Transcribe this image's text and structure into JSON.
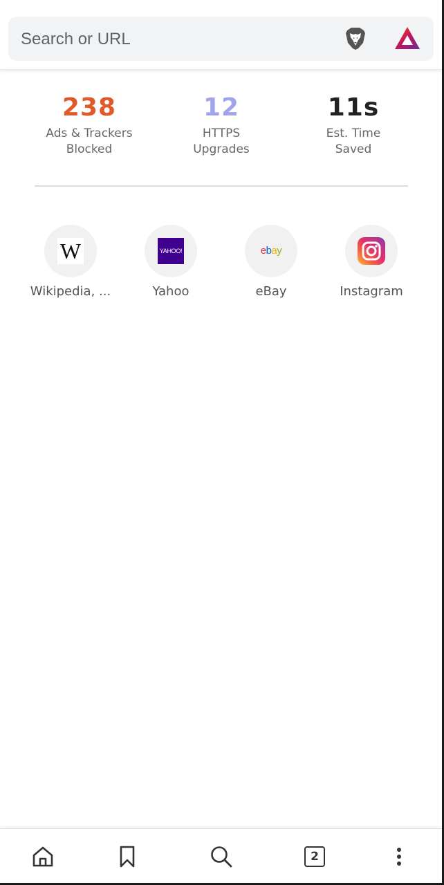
{
  "search": {
    "placeholder": "Search or URL"
  },
  "toolbar": {
    "shield_icon": "brave-lion-shield",
    "rewards_icon": "brave-rewards-triangle"
  },
  "stats": [
    {
      "value": "238",
      "label_line1": "Ads & Trackers",
      "label_line2": "Blocked",
      "color": "#e05a2b"
    },
    {
      "value": "12",
      "label_line1": "HTTPS",
      "label_line2": "Upgrades",
      "color": "#a0a5eb"
    },
    {
      "value": "11s",
      "label_line1": "Est. Time",
      "label_line2": "Saved",
      "color": "#222222"
    }
  ],
  "top_sites": [
    {
      "label": "Wikipedia, ...",
      "logo_text": "W"
    },
    {
      "label": "Yahoo",
      "logo_text": "YAHOO!"
    },
    {
      "label": "eBay",
      "logo_text": "ebay"
    },
    {
      "label": "Instagram",
      "logo_text": ""
    }
  ],
  "bottom_nav": {
    "home_icon": "home-icon",
    "bookmark_icon": "bookmark-icon",
    "search_icon": "search-icon",
    "tabs_count": "2",
    "menu_icon": "more-vertical-icon"
  }
}
